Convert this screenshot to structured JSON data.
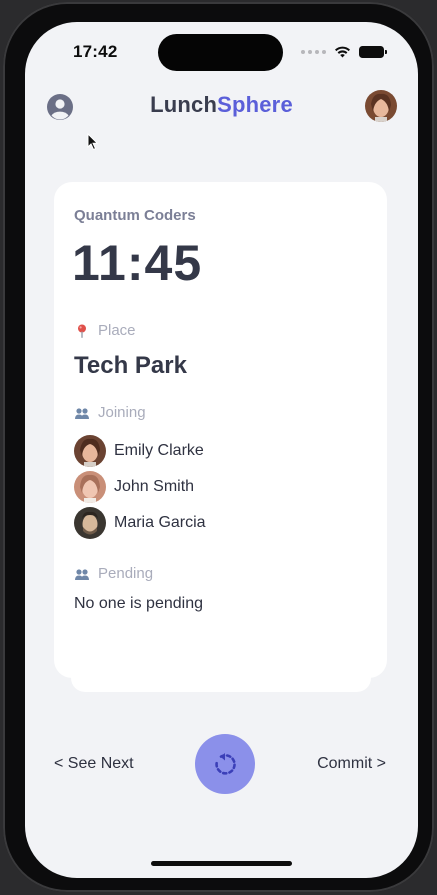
{
  "status_bar": {
    "time": "17:42"
  },
  "header": {
    "brand_part1": "Lunch",
    "brand_part2": "Sphere",
    "profile_icon": "user-circle-icon",
    "avatar_icon": "user-avatar"
  },
  "card": {
    "group_name": "Quantum Coders",
    "time": "11:45",
    "place_label": "Place",
    "place_icon": "pin-icon",
    "place_value": "Tech Park",
    "joining_label": "Joining",
    "joining_icon": "people-icon",
    "joining": [
      {
        "name": "Emily Clarke"
      },
      {
        "name": "John Smith"
      },
      {
        "name": "Maria Garcia"
      }
    ],
    "pending_label": "Pending",
    "pending_icon": "people-icon",
    "pending_text": "No one is pending"
  },
  "nav": {
    "see_next": "< See Next",
    "commit": "Commit >",
    "refresh_icon": "refresh-icon"
  },
  "colors": {
    "brand_primary": "#3a3d4e",
    "brand_accent": "#5b5fd9",
    "refresh_button": "#8b90ea",
    "background": "#f2f3f6"
  }
}
